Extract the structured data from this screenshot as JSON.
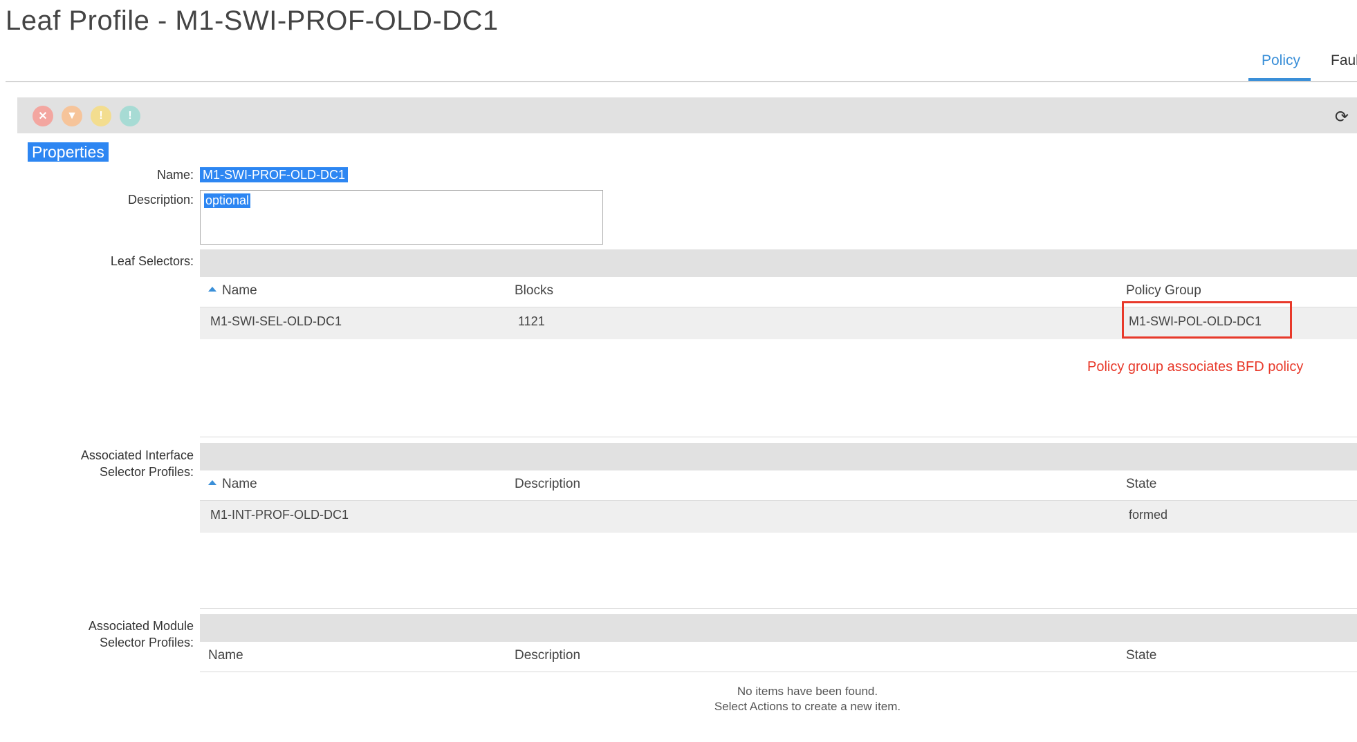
{
  "page": {
    "title": "Leaf Profile - M1-SWI-PROF-OLD-DC1",
    "tabs": [
      "Policy",
      "Faul"
    ]
  },
  "toolbar": {
    "icons": [
      "critical-fault-icon",
      "major-fault-icon",
      "minor-fault-icon",
      "warning-fault-icon",
      "refresh-icon"
    ]
  },
  "properties": {
    "section_title": "Properties",
    "name_label": "Name:",
    "name_value": "M1-SWI-PROF-OLD-DC1",
    "description_label": "Description:",
    "description_placeholder": "optional"
  },
  "leaf_selectors": {
    "label": "Leaf Selectors:",
    "columns": [
      "Name",
      "Blocks",
      "Policy Group"
    ],
    "rows": [
      {
        "name": "M1-SWI-SEL-OLD-DC1",
        "blocks": "1121",
        "policy_group": "M1-SWI-POL-OLD-DC1"
      }
    ],
    "annotation": "Policy group associates BFD policy",
    "annotation_color": "#e8392a"
  },
  "interface_selector_profiles": {
    "label_line1": "Associated Interface",
    "label_line2": "Selector Profiles:",
    "columns": [
      "Name",
      "Description",
      "State"
    ],
    "rows": [
      {
        "name": "M1-INT-PROF-OLD-DC1",
        "description": "",
        "state": "formed"
      }
    ]
  },
  "module_selector_profiles": {
    "label_line1": "Associated Module",
    "label_line2": "Selector Profiles:",
    "columns": [
      "Name",
      "Description",
      "State"
    ],
    "empty_line1": "No items have been found.",
    "empty_line2": "Select Actions to create a new item."
  },
  "colors": {
    "accent": "#3a8fd8",
    "selection": "#2d86f2",
    "header_bar": "#e1e1e1"
  }
}
